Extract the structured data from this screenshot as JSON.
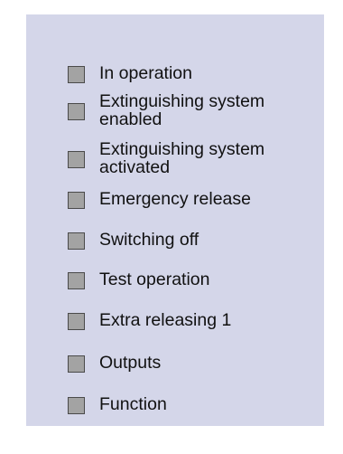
{
  "indicator_panel": {
    "items": [
      {
        "label": "In operation",
        "state": "off"
      },
      {
        "label": "Extinguishing system\nenabled",
        "state": "off"
      },
      {
        "label": "Extinguishing system\nactivated",
        "state": "off"
      },
      {
        "label": "Emergency release",
        "state": "off"
      },
      {
        "label": "Switching off",
        "state": "off"
      },
      {
        "label": "Test operation",
        "state": "off"
      },
      {
        "label": "Extra releasing 1",
        "state": "off"
      },
      {
        "label": "Outputs",
        "state": "off"
      },
      {
        "label": "Function",
        "state": "off"
      }
    ],
    "colors": {
      "panel_background": "#d4d6e9",
      "led_off": "#a3a3a3",
      "led_border": "#4a4a4a"
    }
  }
}
